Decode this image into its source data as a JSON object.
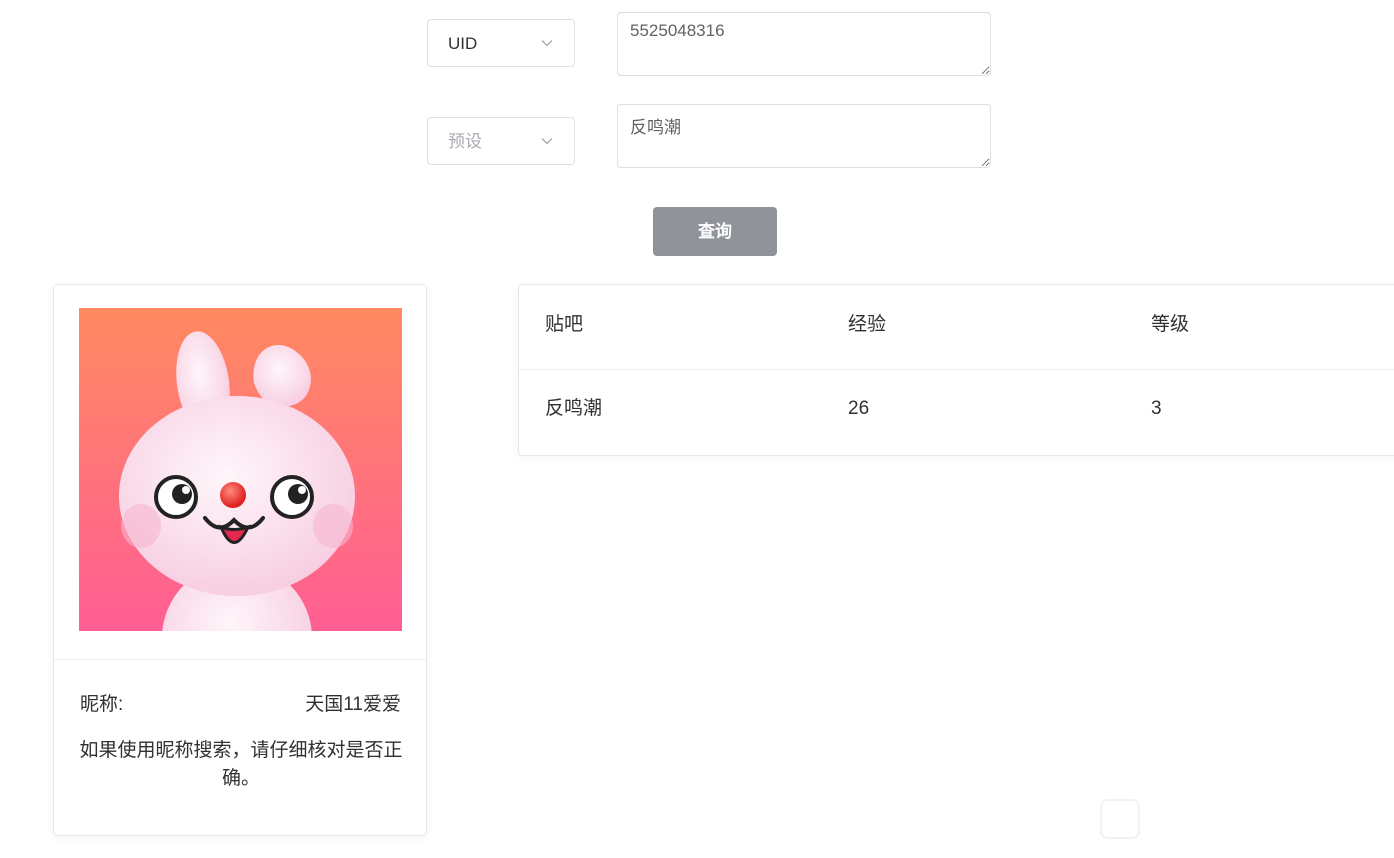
{
  "search": {
    "type_select": {
      "value": "UID",
      "icon": "chevron-down-icon"
    },
    "type_input": {
      "value": "5525048316"
    },
    "preset_select": {
      "placeholder": "预设",
      "icon": "chevron-down-icon"
    },
    "preset_input": {
      "value": "反鸣潮"
    },
    "query_button": "查询"
  },
  "user_card": {
    "avatar": "pink-bunny-avatar",
    "nickname_label": "昵称:",
    "nickname_value": "天国11爱爱",
    "hint": "如果使用昵称搜索，请仔细核对是否正确。"
  },
  "forum_table": {
    "columns": [
      "贴吧",
      "经验",
      "等级"
    ],
    "rows": [
      {
        "forum": "反鸣潮",
        "exp": "26",
        "level": "3"
      }
    ]
  },
  "colors": {
    "button_bg": "#909399",
    "border": "#dcdfe6",
    "avatar_gradient_top": "#ff8a60",
    "avatar_gradient_bottom": "#ff5e94"
  }
}
